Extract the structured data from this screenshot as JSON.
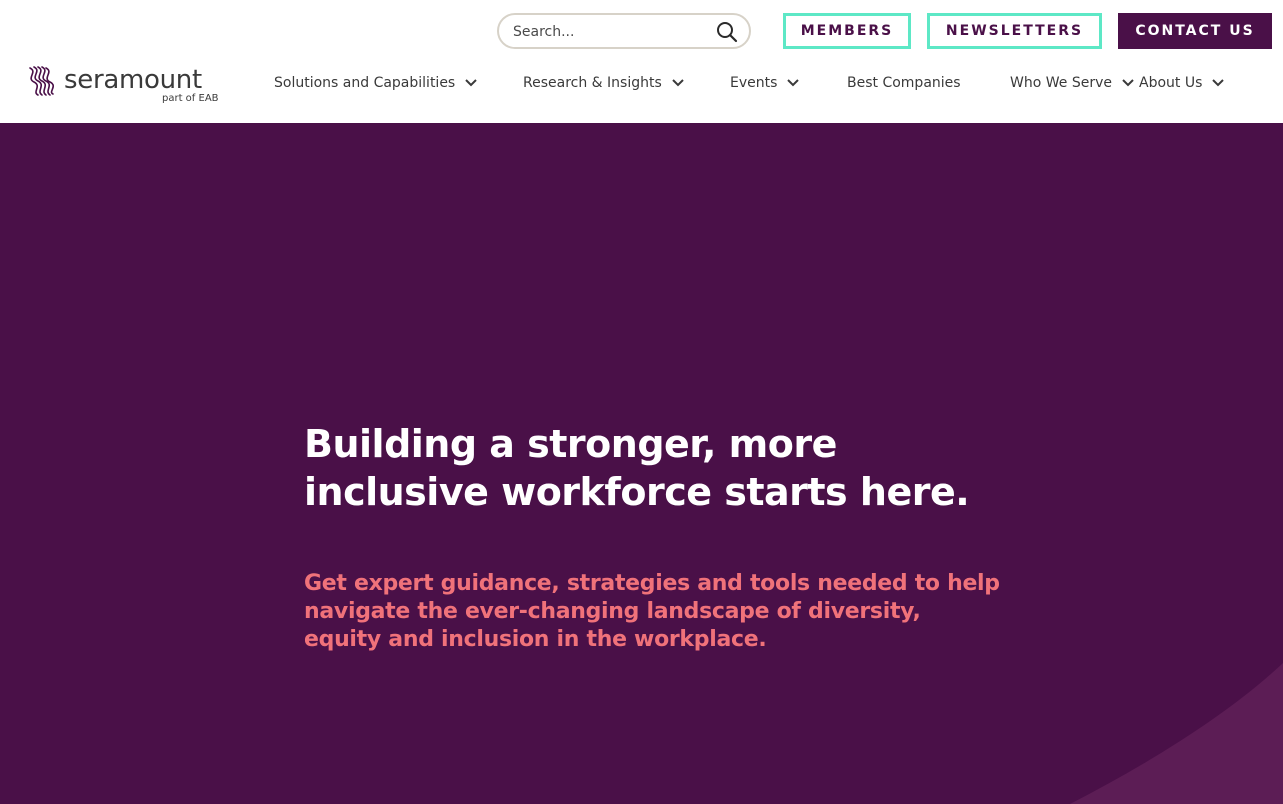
{
  "brand": {
    "name": "seramount",
    "tagline": "part of EAB",
    "primary_color": "#4a1048",
    "accent_color": "#5de8c6",
    "highlight_color": "#f0727a"
  },
  "search": {
    "placeholder": "Search...",
    "icon": "search-icon"
  },
  "utility_buttons": {
    "members": "MEMBERS",
    "newsletters": "NEWSLETTERS",
    "contact": "CONTACT US"
  },
  "nav": {
    "items": [
      {
        "label": "Solutions and Capabilities",
        "has_dropdown": true
      },
      {
        "label": "Research & Insights",
        "has_dropdown": true
      },
      {
        "label": "Events",
        "has_dropdown": true
      },
      {
        "label": "Best Companies",
        "has_dropdown": false
      },
      {
        "label": "Who We Serve",
        "has_dropdown": true
      },
      {
        "label": "About Us",
        "has_dropdown": true
      }
    ]
  },
  "hero": {
    "headline": "Building a stronger, more inclusive workforce starts here.",
    "subheadline": "Get expert guidance, strategies and tools needed to help navigate the ever-changing landscape of diversity, equity and inclusion in the workplace."
  }
}
